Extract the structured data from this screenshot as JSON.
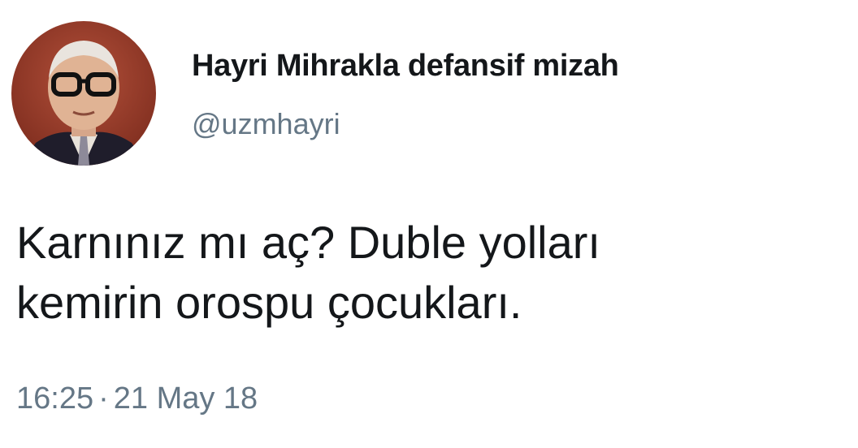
{
  "tweet": {
    "author": {
      "display_name": "Hayri Mihrakla defansif mizah",
      "handle": "@uzmhayri",
      "avatar_icon": "profile-photo"
    },
    "text_lines": [
      "Karnınız mı aç? Duble yolları",
      "kemirin orospu çocukları."
    ],
    "time": "16:25",
    "separator": "·",
    "date": "21 May 18"
  },
  "colors": {
    "text": "#14171a",
    "secondary": "#657786",
    "background": "#ffffff"
  }
}
